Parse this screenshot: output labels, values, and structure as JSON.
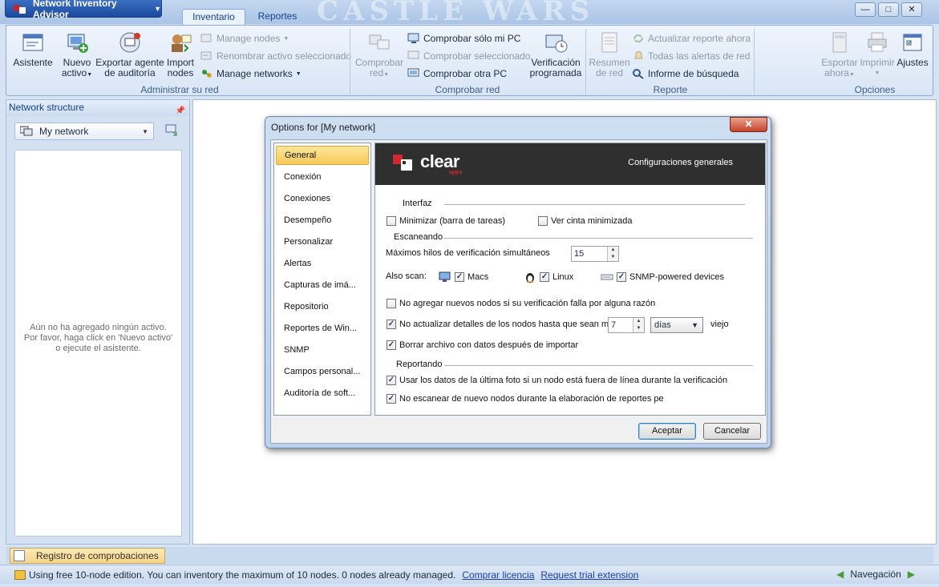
{
  "app": {
    "title": "Network Inventory Advisor",
    "background_title": "CASTLE WARS"
  },
  "window_controls": {
    "minimize": "—",
    "maximize": "□",
    "close": "✕"
  },
  "tabs": [
    {
      "label": "Inventario",
      "active": true
    },
    {
      "label": "Reportes",
      "active": false
    }
  ],
  "ribbon": {
    "groups": {
      "admin": "Administrar su red",
      "check": "Comprobar red",
      "report": "Reporte",
      "options": "Opciones"
    },
    "buttons": {
      "asistente": "Asistente",
      "nuevo_activo_1": "Nuevo",
      "nuevo_activo_2": "activo",
      "exportar_agente_1": "Exportar agente",
      "exportar_agente_2": "de auditoría",
      "import_nodes_1": "Import",
      "import_nodes_2": "nodes",
      "manage_nodes": "Manage nodes",
      "renombrar": "Renombrar activo seleccionado",
      "manage_networks": "Manage networks",
      "comprobar_red_1": "Comprobar",
      "comprobar_red_2": "red",
      "comprobar_solo": "Comprobar sólo mi PC",
      "comprobar_sel": "Comprobar seleccionado",
      "comprobar_otra": "Comprobar otra PC",
      "verificacion_1": "Verificación",
      "verificacion_2": "programada",
      "resumen_1": "Resumen",
      "resumen_2": "de red",
      "actualizar": "Actualizar reporte ahora",
      "alertas": "Todas las alertas de red",
      "informe": "Informe de búsqueda",
      "exportar_ahora_1": "Esportar",
      "exportar_ahora_2": "ahora",
      "imprimir": "Imprimir",
      "ajustes": "Ajustes"
    }
  },
  "left_panel": {
    "title": "Network structure",
    "network": "My network",
    "empty_line1": "Aún no ha agregado ningún activo.",
    "empty_line2": "Por favor, haga click en 'Nuevo activo'",
    "empty_line3": "o ejecute el asistente."
  },
  "bottom_tab": "Registro de comprobaciones",
  "status": {
    "message": "Using free 10-node edition. You can inventory the maximum of 10 nodes. 0 nodes already managed.",
    "link1": "Comprar licencia",
    "link2": "Request trial extension",
    "nav": "Navegación"
  },
  "dialog": {
    "title": "Options for [My network]",
    "close": "✕",
    "categories": [
      "General",
      "Conexión",
      "Conexiones",
      "Desempeño",
      "Personalizar",
      "Alertas",
      "Capturas de imá...",
      "Repositorio",
      "Reportes de Win...",
      "SNMP",
      "Campos personal...",
      "Auditoría de soft..."
    ],
    "selected_category": "General",
    "brand": "clear",
    "brand_sub": "apps",
    "banner_title": "Configuraciones generales",
    "sections": {
      "interfaz": "Interfaz",
      "escaneando": "Escaneando",
      "reportando": "Reportando"
    },
    "options": {
      "minimizar": "Minimizar (barra de tareas)",
      "cinta": "Ver cinta minimizada",
      "max_hilos": "Máximos hilos de verificación simultáneos",
      "max_hilos_value": "15",
      "also_scan": "Also scan:",
      "macs": "Macs",
      "linux": "Linux",
      "snmp": "SNMP-powered devices",
      "no_agregar": "No agregar nuevos nodos si su verificación falla por alguna razón",
      "no_actualizar": "No actualizar detalles de los nodos hasta que sean más",
      "dias_value": "7",
      "dias_unit": "días",
      "viejo": "viejo",
      "borrar": "Borrar archivo con datos después de importar",
      "usar_datos": "Usar los datos de la última foto si un nodo está fuera de línea durante la verificación",
      "no_escanear": "No escanear de nuevo nodos durante la elaboración de reportes pers"
    },
    "checked": {
      "minimizar": false,
      "cinta": false,
      "macs": true,
      "linux": true,
      "snmp": true,
      "no_agregar": false,
      "no_actualizar": true,
      "borrar": true,
      "usar_datos": true,
      "no_escanear": true
    },
    "ok": "Aceptar",
    "cancel": "Cancelar"
  },
  "colors": {
    "accent": "#1c4a9c",
    "selected_item": "#f7c95a",
    "banner": "#2f2f2f",
    "brand_red": "#d3262e"
  }
}
